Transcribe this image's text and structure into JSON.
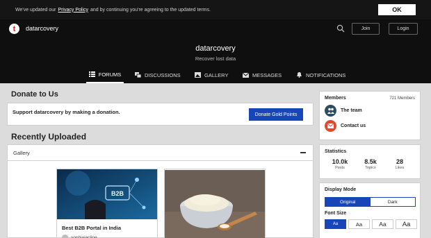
{
  "cookie": {
    "text_before": "We've updated our",
    "link": "Privacy Policy",
    "text_after": "and by continuing you're agreeing to the updated terms.",
    "ok_label": "OK"
  },
  "header": {
    "site_name": "datarcovery",
    "logo_letter": "t",
    "join_label": "Join",
    "login_label": "Login"
  },
  "hero": {
    "title": "datarcovery",
    "subtitle": "Recover lost data"
  },
  "nav": {
    "items": [
      {
        "label": "FORUMS",
        "icon": "list-icon",
        "active": true
      },
      {
        "label": "DISCUSSIONS",
        "icon": "chat-icon"
      },
      {
        "label": "GALLERY",
        "icon": "image-icon"
      },
      {
        "label": "MESSAGES",
        "icon": "envelope-icon"
      },
      {
        "label": "NOTIFICATIONS",
        "icon": "bell-icon"
      }
    ]
  },
  "main": {
    "donate_heading": "Donate to Us",
    "donate_text": "Support datarcovery by making a donation.",
    "donate_button": "Donate Gold Points",
    "recent_heading": "Recently Uploaded",
    "gallery_label": "Gallery",
    "cards": [
      {
        "title": "Best B2B Portal in India",
        "user": "sophiajacline",
        "img_text": "B2B"
      },
      {
        "title": "",
        "user": ""
      }
    ]
  },
  "sidebar": {
    "members": {
      "title": "Members",
      "count": "721 Members",
      "rows": [
        {
          "label": "The team",
          "icon": "team-icon",
          "color": "#2c4d60"
        },
        {
          "label": "Contact us",
          "icon": "envelope-icon",
          "color": "#e8452c"
        }
      ]
    },
    "statistics": {
      "title": "Statistics",
      "items": [
        {
          "value": "10.0k",
          "label": "Posts"
        },
        {
          "value": "8.5k",
          "label": "Topics"
        },
        {
          "value": "28",
          "label": "Likes"
        }
      ]
    },
    "display_mode": {
      "title": "Display Mode",
      "options": [
        "Original",
        "Dark"
      ],
      "selected": "Original"
    },
    "font_size": {
      "title": "Font Size",
      "options": [
        "Aa",
        "Aa",
        "Aa",
        "Aa"
      ]
    }
  },
  "colors": {
    "accent": "#1846b8",
    "header_bg": "#0f0f0f",
    "page_bg": "#dcdcdc"
  }
}
